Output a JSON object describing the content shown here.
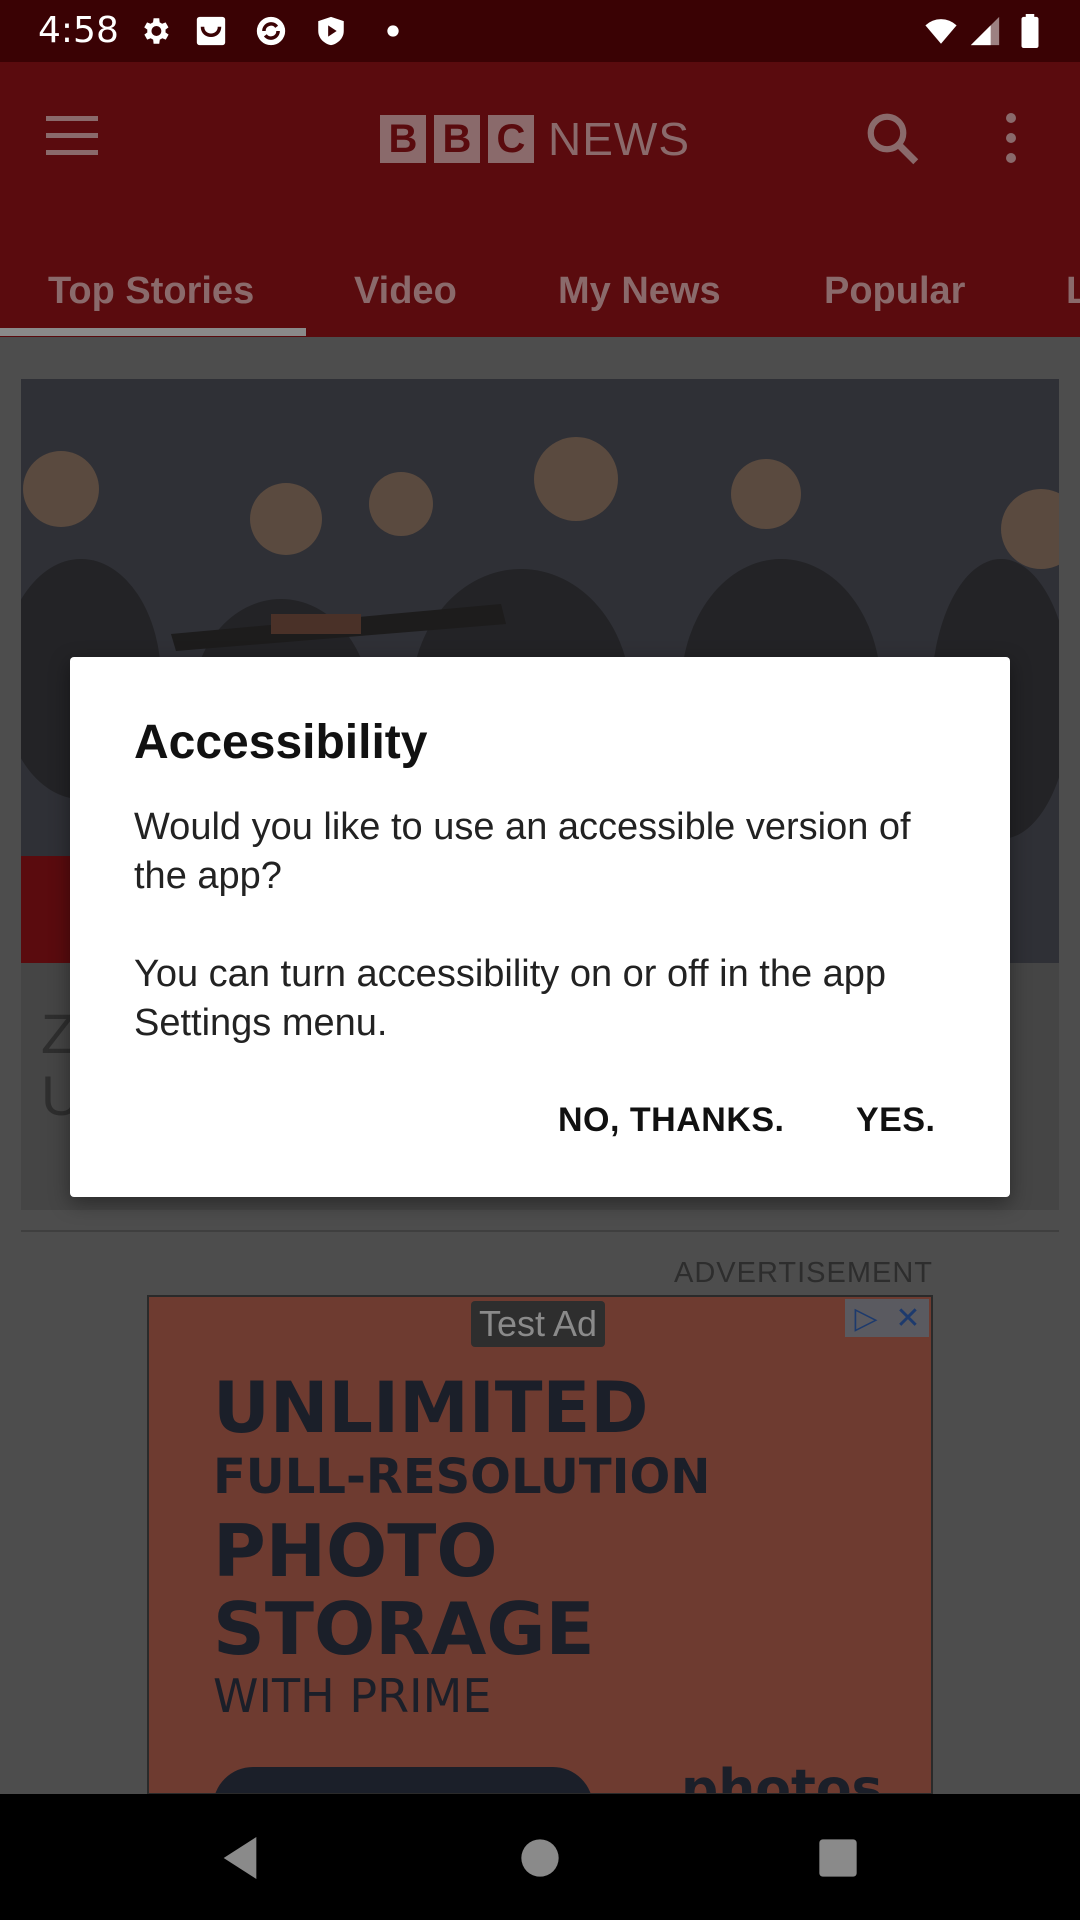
{
  "status_bar": {
    "time": "4:58"
  },
  "app_bar": {
    "logo_letters": [
      "B",
      "B",
      "C"
    ],
    "logo_word": "NEWS",
    "tabs": [
      {
        "label": "Top Stories"
      },
      {
        "label": "Video"
      },
      {
        "label": "My News"
      },
      {
        "label": "Popular"
      },
      {
        "label": "L"
      }
    ]
  },
  "content": {
    "headline_fragment": "Z\nU",
    "advertisement_label": "ADVERTISEMENT",
    "ad": {
      "test_badge": "Test Ad",
      "lines": [
        "UNLIMITED",
        "FULL-RESOLUTION",
        "PHOTO",
        "STORAGE",
        "WITH PRIME"
      ],
      "partial_text": "photos"
    }
  },
  "dialog": {
    "title": "Accessibility",
    "paragraph1": "Would you like to use an accessible version of the app?",
    "paragraph2": "You can turn accessibility on or off in the app Settings menu.",
    "negative_button": "NO, THANKS.",
    "positive_button": "YES."
  },
  "colors": {
    "brand_red": "#bb1919",
    "scrim_red": "#5a0b0e",
    "dialog_bg": "#ffffff"
  },
  "icons": [
    "settings-icon",
    "inbox-icon",
    "sync-icon",
    "shield-play-icon",
    "dot-icon",
    "wifi-icon",
    "signal-icon",
    "battery-icon",
    "menu-icon",
    "search-icon",
    "more-vert-icon",
    "adchoices-icon",
    "close-icon",
    "back-icon",
    "home-icon",
    "recents-icon"
  ]
}
